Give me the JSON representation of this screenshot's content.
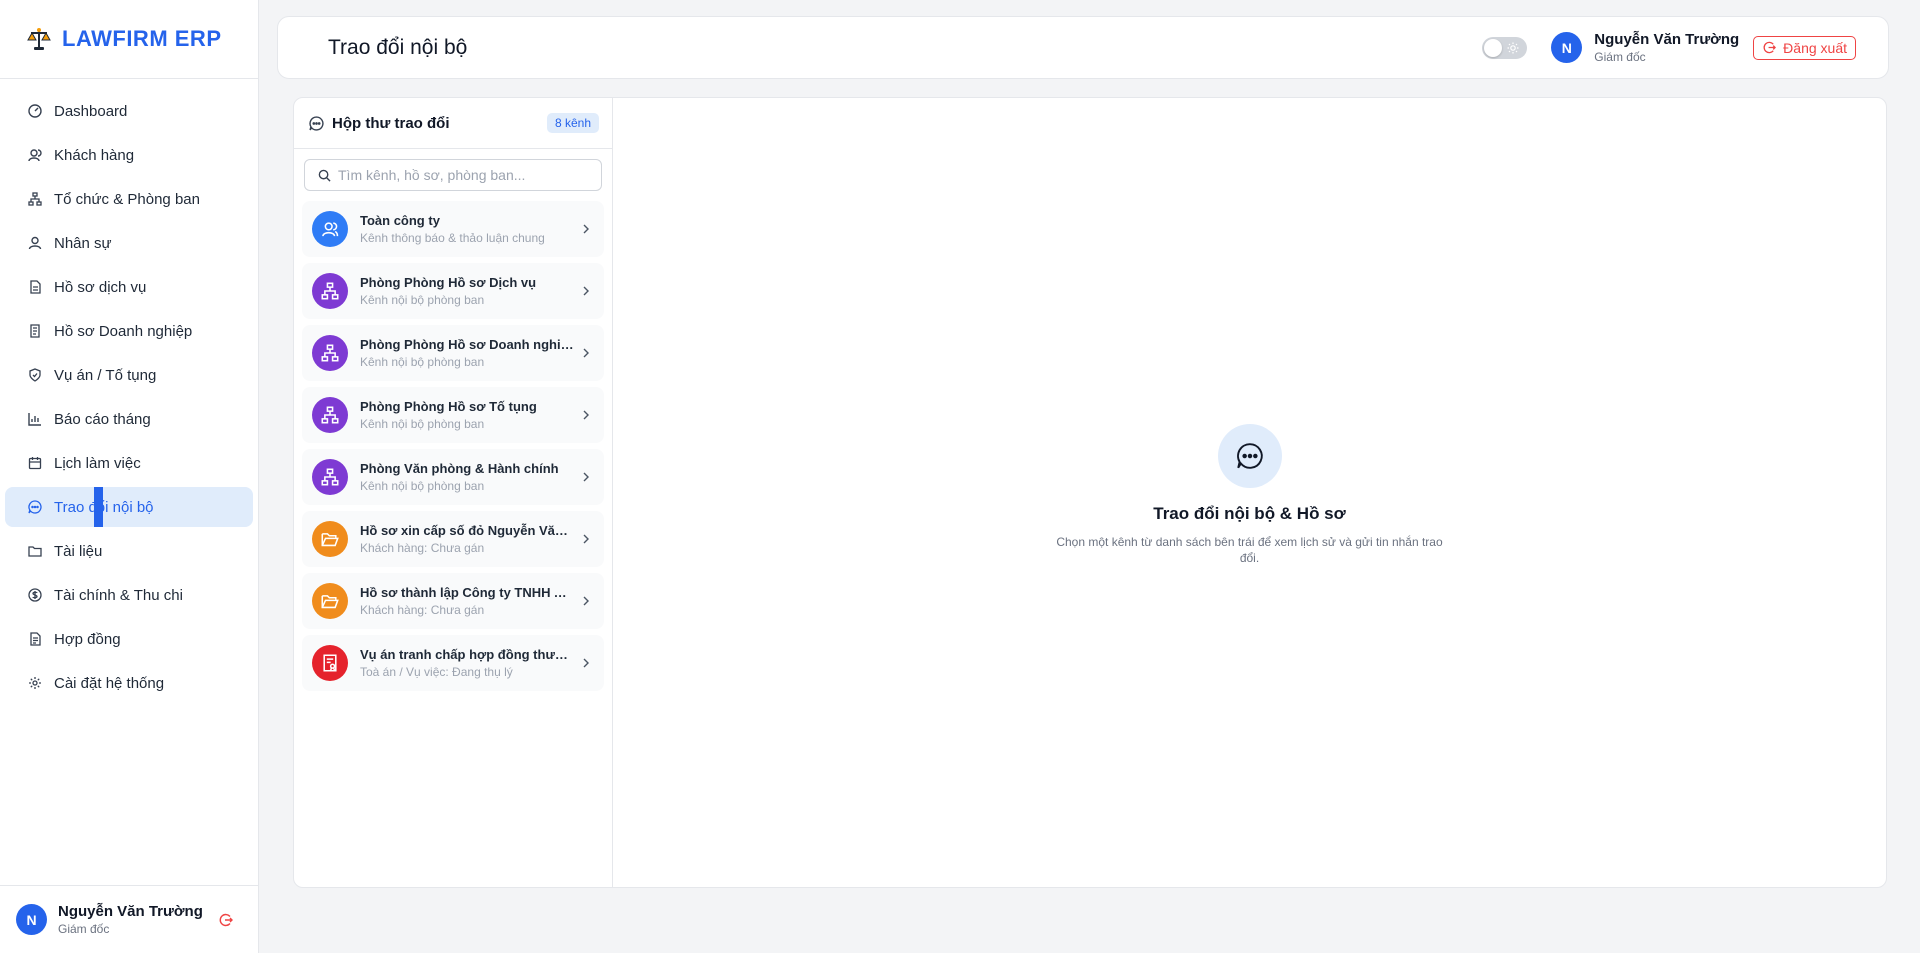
{
  "brand": {
    "name": "LAWFIRM ERP",
    "logo_icon": "scales-of-justice-icon"
  },
  "sidebar": {
    "items": [
      {
        "label": "Dashboard",
        "icon": "gauge-icon"
      },
      {
        "label": "Khách hàng",
        "icon": "users-icon"
      },
      {
        "label": "Tổ chức & Phòng ban",
        "icon": "org-chart-icon"
      },
      {
        "label": "Nhân sự",
        "icon": "user-icon"
      },
      {
        "label": "Hồ sơ dịch vụ",
        "icon": "file-icon"
      },
      {
        "label": "Hồ sơ Doanh nghiệp",
        "icon": "file-text-icon"
      },
      {
        "label": "Vụ án / Tố tụng",
        "icon": "shield-icon"
      },
      {
        "label": "Báo cáo tháng",
        "icon": "bar-chart-icon"
      },
      {
        "label": "Lịch làm việc",
        "icon": "calendar-icon"
      },
      {
        "label": "Trao đổi nội bộ",
        "icon": "chat-icon",
        "active": true
      },
      {
        "label": "Tài liệu",
        "icon": "folder-icon"
      },
      {
        "label": "Tài chính & Thu chi",
        "icon": "dollar-icon"
      },
      {
        "label": "Hợp đồng",
        "icon": "contract-icon"
      },
      {
        "label": "Cài đặt hệ thống",
        "icon": "gear-icon"
      }
    ],
    "user": {
      "initial": "N",
      "name": "Nguyễn Văn Trường",
      "role": "Giám đốc"
    }
  },
  "header": {
    "title": "Trao đổi nội bộ",
    "user": {
      "initial": "N",
      "name": "Nguyễn Văn Trường",
      "role": "Giám đốc"
    },
    "logout_label": "Đăng xuất"
  },
  "inbox": {
    "title": "Hộp thư trao đổi",
    "count_badge": "8 kênh",
    "search_placeholder": "Tìm kênh, hồ sơ, phòng ban...",
    "channels": [
      {
        "name": "Toàn công ty",
        "sub": "Kênh thông báo & thảo luận chung",
        "icon": "users-icon",
        "color": "#2f7cf6"
      },
      {
        "name": "Phòng Phòng Hồ sơ Dịch vụ",
        "sub": "Kênh nội bộ phòng ban",
        "icon": "org-chart-icon",
        "color": "#7e3ad3"
      },
      {
        "name": "Phòng Phòng Hồ sơ Doanh nghiệp",
        "sub": "Kênh nội bộ phòng ban",
        "icon": "org-chart-icon",
        "color": "#7e3ad3"
      },
      {
        "name": "Phòng Phòng Hồ sơ Tố tụng",
        "sub": "Kênh nội bộ phòng ban",
        "icon": "org-chart-icon",
        "color": "#7e3ad3"
      },
      {
        "name": "Phòng Văn phòng & Hành chính",
        "sub": "Kênh nội bộ phòng ban",
        "icon": "org-chart-icon",
        "color": "#7e3ad3"
      },
      {
        "name": "Hồ sơ xin cấp số đỏ Nguyễn Văn A",
        "sub": "Khách hàng: Chưa gán",
        "icon": "folder-open-icon",
        "color": "#f08c1c"
      },
      {
        "name": "Hồ sơ thành lập Công ty TNHH ABC",
        "sub": "Khách hàng: Chưa gán",
        "icon": "folder-open-icon",
        "color": "#f08c1c"
      },
      {
        "name": "Vụ án tranh chấp hợp đồng thương...",
        "sub": "Toà án / Vụ việc: Đang thụ lý",
        "icon": "case-file-icon",
        "color": "#e5232c"
      }
    ]
  },
  "empty_state": {
    "title": "Trao đổi nội bộ & Hồ sơ",
    "description": "Chọn một kênh từ danh sách bên trái để xem lịch sử và gửi tin nhắn trao đổi.",
    "icon": "chat-bubble-icon"
  },
  "colors": {
    "accent": "#2563eb",
    "danger": "#ef4444",
    "active_bg": "#e0ecfb"
  }
}
